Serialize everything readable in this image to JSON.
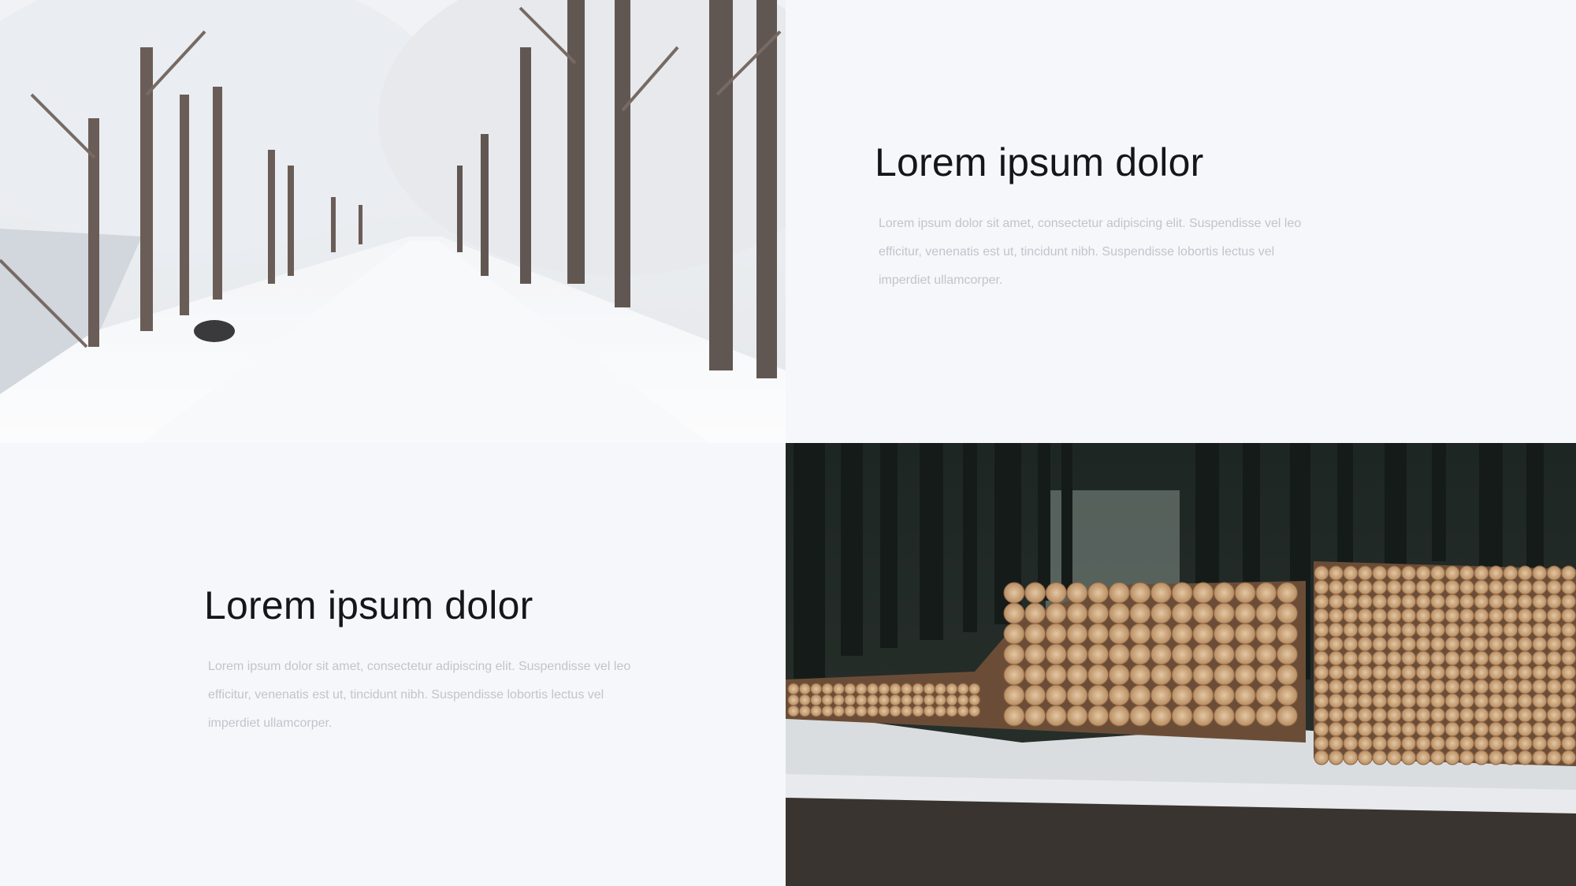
{
  "slide": {
    "top_right": {
      "heading": "Lorem ipsum dolor",
      "body": "Lorem ipsum dolor sit amet, consectetur adipiscing elit. Suspendisse vel leo efficitur, venenatis est ut, tincidunt nibh. Suspendisse lobortis lectus vel imperdiet ullamcorper."
    },
    "bottom_left": {
      "heading": "Lorem ipsum dolor",
      "body": "Lorem ipsum dolor sit amet, consectetur adipiscing elit. Suspendisse vel leo efficitur, venenatis est ut, tincidunt nibh. Suspendisse lobortis lectus vel imperdiet ullamcorper."
    }
  },
  "colors": {
    "background": "#f6f7fb",
    "heading": "#15151a",
    "body_text": "#c2c4cc"
  }
}
